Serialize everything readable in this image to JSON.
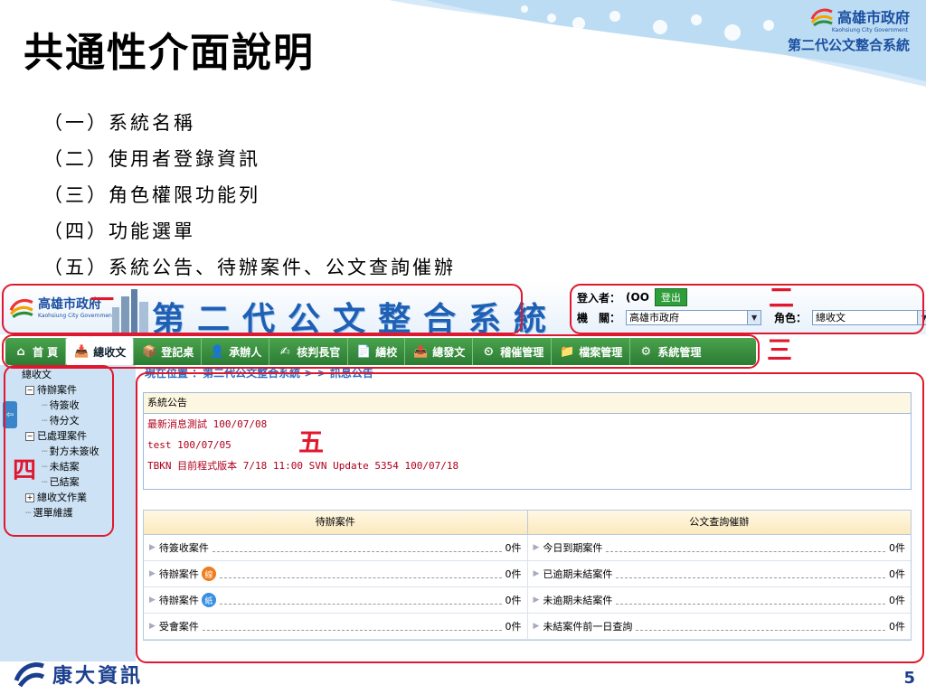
{
  "slide": {
    "title": "共通性介面說明",
    "outline": [
      "（一）系統名稱",
      "（二）使用者登錄資訊",
      "（三）角色權限功能列",
      "（四）功能選單",
      "（五）系統公告、待辦案件、公文查詢催辦"
    ],
    "brand_name": "高雄市政府",
    "brand_sub": "Kaohsiung City Government",
    "brand_system": "第二代公文整合系統",
    "page_number": "5",
    "footer_company": "康大資訊"
  },
  "annotations": {
    "one": "一",
    "two": "二",
    "three": "三",
    "four": "四",
    "five": "五"
  },
  "app": {
    "logo_name": "高雄市政府",
    "logo_sub": "Kaohsiung City Government",
    "title": "第二代公文整合系統",
    "login_label": "登入者：",
    "login_user": "(OO",
    "logout_label": "登出",
    "agency_label": "機　關：",
    "agency_value": "高雄市政府",
    "role_label": "角色：",
    "role_value": "總收文"
  },
  "menu": [
    {
      "label": "首 頁",
      "icon": "home-icon",
      "glyph": "⌂",
      "active": false
    },
    {
      "label": "總收文",
      "icon": "inbox-icon",
      "glyph": "📥",
      "active": true
    },
    {
      "label": "登記桌",
      "icon": "desk-icon",
      "glyph": "📦",
      "active": false
    },
    {
      "label": "承辦人",
      "icon": "person-icon",
      "glyph": "👤",
      "active": false
    },
    {
      "label": "核判長官",
      "icon": "stamp-icon",
      "glyph": "✍",
      "active": false
    },
    {
      "label": "繕校",
      "icon": "document-icon",
      "glyph": "📄",
      "active": false
    },
    {
      "label": "總發文",
      "icon": "outbox-icon",
      "glyph": "📤",
      "active": false
    },
    {
      "label": "稽催管理",
      "icon": "clock-icon",
      "glyph": "⏲",
      "active": false
    },
    {
      "label": "檔案管理",
      "icon": "folder-icon",
      "glyph": "📁",
      "active": false
    },
    {
      "label": "系統管理",
      "icon": "settings-icon",
      "glyph": "⚙",
      "active": false
    }
  ],
  "sidebar": {
    "collapse_glyph": "⇦",
    "tree": [
      {
        "label": "總收文",
        "level": 0,
        "box": ""
      },
      {
        "label": "待辦案件",
        "level": 1,
        "box": "−"
      },
      {
        "label": "待簽收",
        "level": 2,
        "box": ""
      },
      {
        "label": "待分文",
        "level": 2,
        "box": ""
      },
      {
        "label": "已處理案件",
        "level": 1,
        "box": "−"
      },
      {
        "label": "對方未簽收",
        "level": 2,
        "box": ""
      },
      {
        "label": "未結案",
        "level": 2,
        "box": ""
      },
      {
        "label": "已結案",
        "level": 2,
        "box": ""
      },
      {
        "label": "總收文作業",
        "level": 1,
        "box": "+"
      },
      {
        "label": "選單維護",
        "level": 1,
        "box": ""
      }
    ]
  },
  "content": {
    "breadcrumb": "現在位置 ：第二代公文整合系統 > > 訊息公告",
    "notice_header": "系統公告",
    "notices": [
      "最新消息測試 100/07/08",
      "test 100/07/05",
      "TBKN 目前程式版本 7/18 11:00 SVN Update 5354 100/07/18"
    ],
    "left_header": "待辦案件",
    "right_header": "公文查詢催辦",
    "rows": [
      {
        "left": "待簽收案件",
        "left_badge": "",
        "left_count": "0件",
        "right": "今日到期案件",
        "right_count": "0件"
      },
      {
        "left": "待辦案件",
        "left_badge": "線",
        "left_count": "0件",
        "right": "已逾期未結案件",
        "right_count": "0件"
      },
      {
        "left": "待辦案件",
        "left_badge": "紙",
        "left_count": "0件",
        "right": "未逾期未結案件",
        "right_count": "0件"
      },
      {
        "left": "受會案件",
        "left_badge": "",
        "left_count": "0件",
        "right": "未結案件前一日查詢",
        "right_count": "0件"
      }
    ]
  }
}
